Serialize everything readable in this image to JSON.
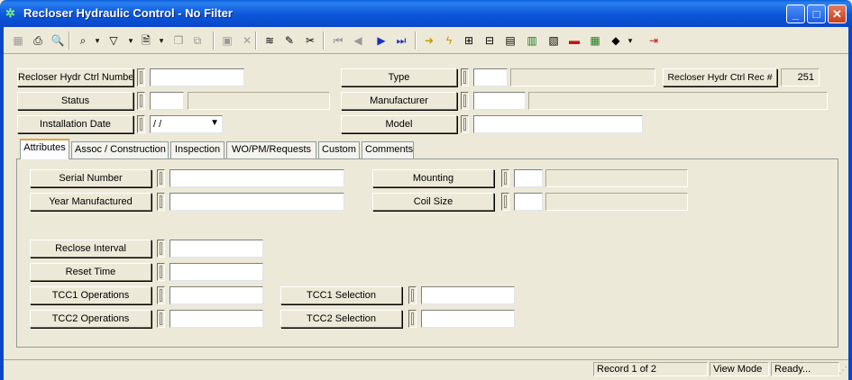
{
  "window": {
    "title": "Recloser Hydraulic Control - No Filter",
    "minimize": "_",
    "maximize": "□",
    "close": "✕"
  },
  "toolbar": {
    "icons": [
      {
        "name": "grid-icon",
        "glyph": "▦"
      },
      {
        "name": "print-icon",
        "glyph": "⎙"
      },
      {
        "name": "print-preview-icon",
        "glyph": "🔍"
      },
      {
        "name": "binoculars-icon",
        "glyph": "⌕"
      },
      {
        "name": "dropdown-arrow-icon",
        "glyph": "▾"
      },
      {
        "name": "filter-icon",
        "glyph": "▽"
      },
      {
        "name": "dropdown-arrow-icon",
        "glyph": "▾"
      },
      {
        "name": "new-record-icon",
        "glyph": "🗎"
      },
      {
        "name": "dropdown-arrow-icon",
        "glyph": "▾"
      },
      {
        "name": "copy-record-icon",
        "glyph": "❐"
      },
      {
        "name": "duplicate-icon",
        "glyph": "⧉"
      },
      {
        "name": "save-icon",
        "glyph": "▣"
      },
      {
        "name": "delete-icon",
        "glyph": "✕"
      },
      {
        "name": "stack-icon",
        "glyph": "≋"
      },
      {
        "name": "edit-pencil-icon",
        "glyph": "✎"
      },
      {
        "name": "cut-icon",
        "glyph": "✂"
      },
      {
        "name": "first-record-icon",
        "glyph": "⏮"
      },
      {
        "name": "previous-record-icon",
        "glyph": "◀"
      },
      {
        "name": "next-record-icon",
        "glyph": "▶"
      },
      {
        "name": "last-record-icon",
        "glyph": "⏭"
      },
      {
        "name": "go-to-icon",
        "glyph": "➜"
      },
      {
        "name": "lightning-icon",
        "glyph": "ϟ"
      },
      {
        "name": "relations-icon",
        "glyph": "⊞"
      },
      {
        "name": "hierarchy-icon",
        "glyph": "⊟"
      },
      {
        "name": "map-icon",
        "glyph": "▤"
      },
      {
        "name": "calculator-icon",
        "glyph": "▥"
      },
      {
        "name": "report-icon",
        "glyph": "▧"
      },
      {
        "name": "truck-icon",
        "glyph": "▬"
      },
      {
        "name": "table-icon",
        "glyph": "▦"
      },
      {
        "name": "book-icon",
        "glyph": "◆"
      },
      {
        "name": "dropdown-arrow-icon",
        "glyph": "▾"
      },
      {
        "name": "exit-icon",
        "glyph": "⇥"
      }
    ]
  },
  "header": {
    "ctrl_number_label": "Recloser Hydr Ctrl Number",
    "ctrl_number_value": "",
    "status_label": "Status",
    "status_code": "",
    "status_desc": "",
    "install_date_label": "Installation Date",
    "install_date_value": " / /",
    "type_label": "Type",
    "type_code": "",
    "type_desc": "",
    "rec_no_label": "Recloser Hydr Ctrl Rec #",
    "rec_no_value": "251",
    "manufacturer_label": "Manufacturer",
    "manufacturer_code": "",
    "manufacturer_desc": "",
    "model_label": "Model",
    "model_value": ""
  },
  "tabs": [
    {
      "label": "Attributes",
      "active": true
    },
    {
      "label": "Assoc / Construction",
      "active": false
    },
    {
      "label": "Inspection",
      "active": false
    },
    {
      "label": "WO/PM/Requests",
      "active": false
    },
    {
      "label": "Custom",
      "active": false
    },
    {
      "label": "Comments",
      "active": false
    }
  ],
  "attributes": {
    "serial_number_label": "Serial Number",
    "serial_number_value": "",
    "year_manufactured_label": "Year Manufactured",
    "year_manufactured_value": "",
    "mounting_label": "Mounting",
    "mounting_code": "",
    "mounting_desc": "",
    "coil_size_label": "Coil Size",
    "coil_size_code": "",
    "coil_size_desc": "",
    "reclose_interval_label": "Reclose Interval",
    "reclose_interval_value": "",
    "reset_time_label": "Reset Time",
    "reset_time_value": "",
    "tcc1_operations_label": "TCC1 Operations",
    "tcc1_operations_value": "",
    "tcc2_operations_label": "TCC2 Operations",
    "tcc2_operations_value": "",
    "tcc1_selection_label": "TCC1 Selection",
    "tcc1_selection_value": "",
    "tcc2_selection_label": "TCC2 Selection",
    "tcc2_selection_value": ""
  },
  "status_bar": {
    "record": "Record 1 of 2",
    "mode": "View Mode",
    "state": "Ready..."
  }
}
